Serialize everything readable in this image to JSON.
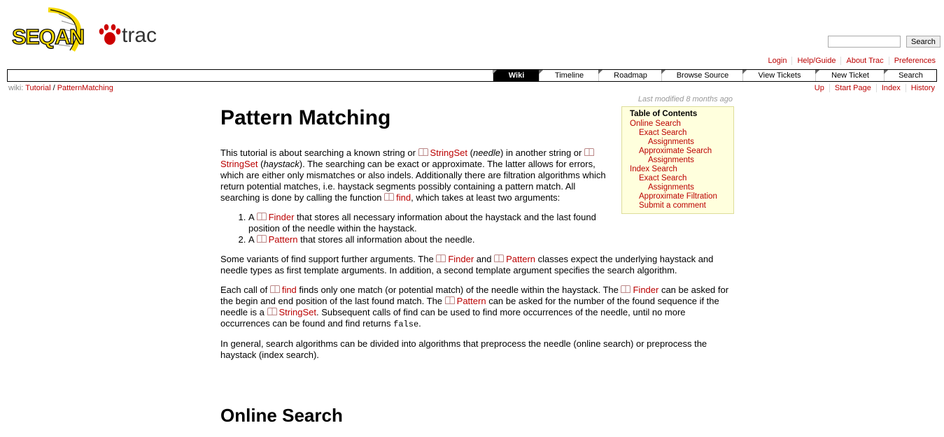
{
  "logo": {
    "text_left": "SEQAN",
    "text_right": "trac",
    "paw_color": "#cc0000",
    "accent": "#f5d800"
  },
  "search": {
    "placeholder": "",
    "button_label": "Search"
  },
  "metanav": [
    "Login",
    "Help/Guide",
    "About Trac",
    "Preferences"
  ],
  "mainnav": [
    "Wiki",
    "Timeline",
    "Roadmap",
    "Browse Source",
    "View Tickets",
    "New Ticket",
    "Search"
  ],
  "breadcrumb": {
    "prefix": "wiki:",
    "part1": "Tutorial",
    "sep": "/",
    "part2": "PatternMatching"
  },
  "ctxtnav": [
    "Up",
    "Start Page",
    "Index",
    "History"
  ],
  "last_modified": "Last modified 8 months ago",
  "toc": {
    "title": "Table of Contents",
    "items": [
      {
        "label": "Online Search",
        "level": 1
      },
      {
        "label": "Exact Search",
        "level": 2
      },
      {
        "label": "Assignments",
        "level": 3
      },
      {
        "label": "Approximate Search",
        "level": 2
      },
      {
        "label": "Assignments",
        "level": 3
      },
      {
        "label": "Index Search",
        "level": 1
      },
      {
        "label": "Exact Search",
        "level": 2
      },
      {
        "label": "Assignments",
        "level": 3
      },
      {
        "label": "Approximate Filtration",
        "level": 2
      },
      {
        "label": "Submit a comment",
        "level": 2
      }
    ]
  },
  "content": {
    "title": "Pattern Matching",
    "p1": {
      "t1": "This tutorial is about searching a known string or ",
      "l1": "StringSet",
      "t2": " (",
      "e1": "needle",
      "t3": ") in another string or ",
      "l2": "StringSet",
      "t4": " (",
      "e2": "haystack",
      "t5": "). The searching can be exact or approximate. The latter allows for errors, which are either only mismatches or also indels. Additionally there are filtration algorithms which return potential matches, i.e. haystack segments possibly containing a pattern match. All searching is done by calling the function ",
      "l3": "find",
      "t6": ", which takes at least two arguments:"
    },
    "list": [
      {
        "pre": "A ",
        "link": "Finder",
        "post": " that stores all necessary information about the haystack and the last found position of the needle within the haystack."
      },
      {
        "pre": "A ",
        "link": "Pattern",
        "post": " that stores all information about the needle."
      }
    ],
    "p2": {
      "t1": "Some variants of find support further arguments. The ",
      "l1": "Finder",
      "t2": " and ",
      "l2": "Pattern",
      "t3": " classes expect the underlying haystack and needle types as first template arguments. In addition, a second template argument specifies the search algorithm."
    },
    "p3": {
      "t1": "Each call of ",
      "l1": "find",
      "t2": " finds only one match (or potential match) of the needle within the haystack. The ",
      "l2": "Finder",
      "t3": " can be asked for the begin and end position of the last found match. The ",
      "l3": "Pattern",
      "t4": " can be asked for the number of the found sequence if the needle is a ",
      "l4": "StringSet",
      "t5": ". Subsequent calls of find can be used to find more occurrences of the needle, until no more occurrences can be found and find returns ",
      "code": "false",
      "t6": "."
    },
    "p4": "In general, search algorithms can be divided into algorithms that preprocess the needle (online search) or preprocess the haystack (index search).",
    "h2": "Online Search"
  }
}
